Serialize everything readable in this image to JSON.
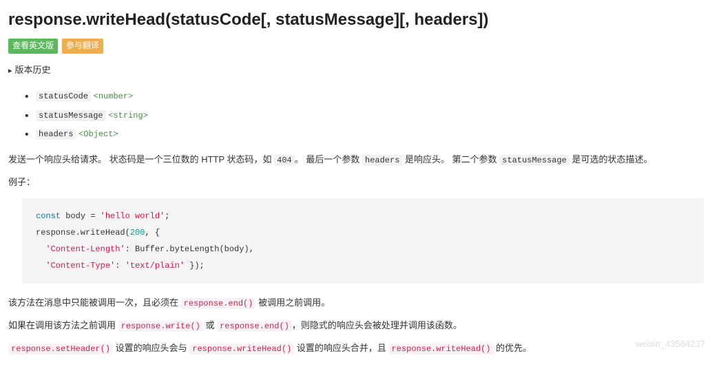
{
  "title": "response.writeHead(statusCode[, statusMessage][, headers])",
  "badges": {
    "view_en": "查看英文版",
    "translate": "参与翻译"
  },
  "history_label": "版本历史",
  "params": [
    {
      "name": "statusCode",
      "type": "<number>"
    },
    {
      "name": "statusMessage",
      "type": "<string>"
    },
    {
      "name": "headers",
      "type": "<Object>"
    }
  ],
  "desc": {
    "p1_a": "发送一个响应头给请求。 状态码是一个三位数的 HTTP 状态码，如 ",
    "p1_code1": "404",
    "p1_b": "。 最后一个参数 ",
    "p1_code2": "headers",
    "p1_c": " 是响应头。 第二个参数 ",
    "p1_code3": "statusMessage",
    "p1_d": " 是可选的状态描述。"
  },
  "example_label": "例子：",
  "code": {
    "l1_kw": "const",
    "l1_var": " body = ",
    "l1_str": "'hello world'",
    "l1_end": ";",
    "l2_a": "response.writeHead(",
    "l2_num": "200",
    "l2_b": ", {",
    "l3_key": "'Content-Length'",
    "l3_rest": ": Buffer.byteLength(body),",
    "l4_key": "'Content-Type'",
    "l4_colon": ": ",
    "l4_val": "'text/plain'",
    "l4_end": " });"
  },
  "para2": {
    "a": "该方法在消息中只能被调用一次，且必须在 ",
    "code1": "response.end()",
    "b": " 被调用之前调用。"
  },
  "para3": {
    "a": "如果在调用该方法之前调用 ",
    "code1": "response.write()",
    "b": " 或 ",
    "code2": "response.end()",
    "c": "，则隐式的响应头会被处理并调用该函数。"
  },
  "para4": {
    "code1": "response.setHeader()",
    "a": " 设置的响应头会与 ",
    "code2": "response.writeHead()",
    "b": " 设置的响应头合并，且 ",
    "code3": "response.writeHead()",
    "c": " 的优先。"
  },
  "watermark": "weixin_43564237"
}
